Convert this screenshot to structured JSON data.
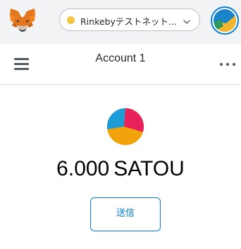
{
  "header": {
    "logo_icon": "metamask-fox-icon",
    "network": {
      "label": "Rinkebyテストネット...",
      "status_color": "#f6c343",
      "chevron_icon": "chevron-down-icon"
    },
    "avatar_icon": "account-identicon"
  },
  "account_bar": {
    "menu_icon": "hamburger-menu-icon",
    "account_name": "Account 1",
    "options_icon": "more-options-icon"
  },
  "balance": {
    "token_icon": "token-identicon",
    "amount": "6.000",
    "symbol": "SATOU"
  },
  "actions": {
    "send_label": "送信"
  },
  "colors": {
    "accent": "#037dd6",
    "header_bg": "#f2f3f4",
    "divider": "#d6d9dc"
  }
}
